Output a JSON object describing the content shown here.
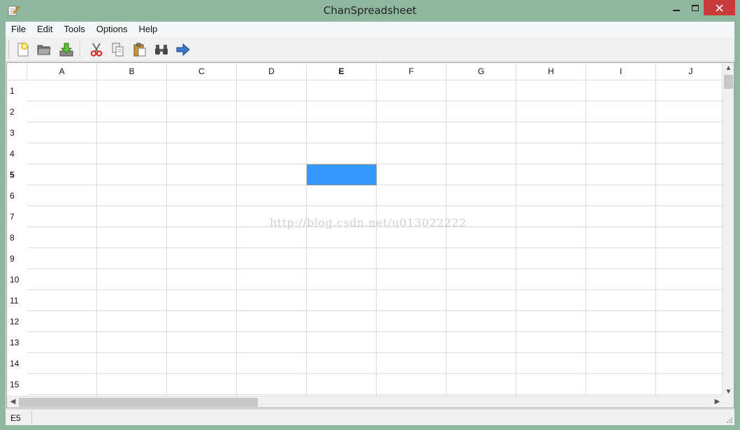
{
  "window": {
    "title": "ChanSpreadsheet",
    "icon": "pencil-document-icon"
  },
  "menubar": {
    "items": [
      "File",
      "Edit",
      "Tools",
      "Options",
      "Help"
    ]
  },
  "toolbar": {
    "buttons": [
      "new-file-icon",
      "open-folder-icon",
      "save-download-icon",
      "cut-icon",
      "copy-icon",
      "paste-icon",
      "find-binoculars-icon",
      "go-to-cell-arrow-icon"
    ]
  },
  "grid": {
    "columns": [
      "A",
      "B",
      "C",
      "D",
      "E",
      "F",
      "G",
      "H",
      "I",
      "J"
    ],
    "rows": [
      "1",
      "2",
      "3",
      "4",
      "5",
      "6",
      "7",
      "8",
      "9",
      "10",
      "11",
      "12",
      "13",
      "14",
      "15"
    ],
    "current_column": "E",
    "current_row": "5",
    "selection_color": "#3399ff",
    "watermark": "http://blog.csdn.net/u013022222"
  },
  "statusbar": {
    "location": "E5",
    "formula": ""
  },
  "colors": {
    "window_frame": "#8fb79f",
    "close_button": "#c73b3b",
    "grid_line": "#dcdcdc"
  }
}
